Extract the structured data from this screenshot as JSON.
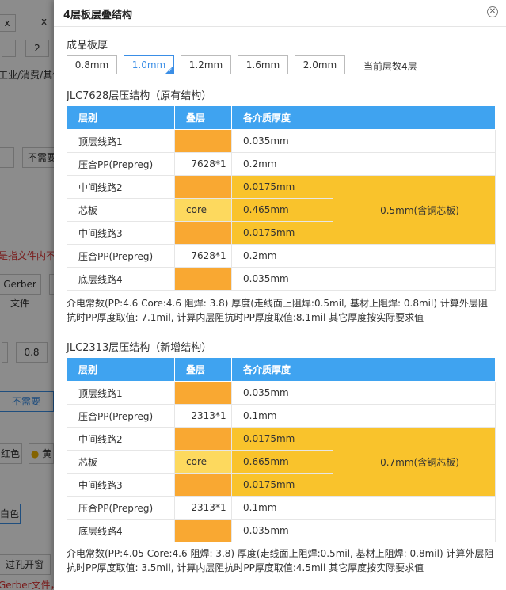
{
  "background": {
    "items": [
      "x",
      "2",
      "x",
      "工业/消费/其他",
      "不需要",
      "是指文件内不",
      "Gerber文件",
      "0.8",
      "不需要",
      "红色",
      "黄",
      "白色",
      "过孔开窗",
      "Gerber文件，一律"
    ]
  },
  "modal": {
    "title": "4层板层叠结构",
    "close_icon": "close-icon",
    "thickness_label": "成品板厚",
    "thickness_options": [
      "0.8mm",
      "1.0mm",
      "1.2mm",
      "1.6mm",
      "2.0mm"
    ],
    "selected_thickness": "1.0mm",
    "layer_count_text": "当前层数4层"
  },
  "stack1": {
    "title": "JLC7628层压结构（原有结构）",
    "headers": [
      "层别",
      "叠层",
      "各介质厚度",
      ""
    ],
    "rows": [
      {
        "layer": "顶层线路1",
        "stack": "",
        "thickness": "0.035mm"
      },
      {
        "layer": "压合PP(Prepreg)",
        "stack": "7628*1",
        "thickness": "0.2mm"
      },
      {
        "layer": "中间线路2",
        "stack": "",
        "thickness": "0.0175mm"
      },
      {
        "layer": "芯板",
        "stack": "core",
        "thickness": "0.465mm"
      },
      {
        "layer": "中间线路3",
        "stack": "",
        "thickness": "0.0175mm"
      },
      {
        "layer": "压合PP(Prepreg)",
        "stack": "7628*1",
        "thickness": "0.2mm"
      },
      {
        "layer": "底层线路4",
        "stack": "",
        "thickness": "0.035mm"
      }
    ],
    "core_total": "0.5mm(含铜芯板)",
    "note": "介电常数(PP:4.6 Core:4.6 阻焊: 3.8) 厚度(走线面上阻焊:0.5mil, 基材上阻焊: 0.8mil) 计算外层阻抗时PP厚度取值: 7.1mil, 计算内层阻抗时PP厚度取值:8.1mil 其它厚度按实际要求值"
  },
  "stack2": {
    "title": "JLC2313层压结构（新增结构）",
    "headers": [
      "层别",
      "叠层",
      "各介质厚度",
      ""
    ],
    "rows": [
      {
        "layer": "顶层线路1",
        "stack": "",
        "thickness": "0.035mm"
      },
      {
        "layer": "压合PP(Prepreg)",
        "stack": "2313*1",
        "thickness": "0.1mm"
      },
      {
        "layer": "中间线路2",
        "stack": "",
        "thickness": "0.0175mm"
      },
      {
        "layer": "芯板",
        "stack": "core",
        "thickness": "0.665mm"
      },
      {
        "layer": "中间线路3",
        "stack": "",
        "thickness": "0.0175mm"
      },
      {
        "layer": "压合PP(Prepreg)",
        "stack": "2313*1",
        "thickness": "0.1mm"
      },
      {
        "layer": "底层线路4",
        "stack": "",
        "thickness": "0.035mm"
      }
    ],
    "core_total": "0.7mm(含铜芯板)",
    "note": "介电常数(PP:4.05 Core:4.6 阻焊: 3.8) 厚度(走线面上阻焊:0.5mil, 基材上阻焊: 0.8mil) 计算外层阻抗时PP厚度取值: 3.5mil, 计算内层阻抗时PP厚度取值:4.5mil 其它厚度按实际要求值"
  },
  "colors": {
    "header_blue": "#3fa3f0",
    "copper_orange": "#f9a832",
    "core_yellow": "#fdd95e",
    "merged_gold": "#f9c32c",
    "active_blue": "#3a8ee6"
  }
}
